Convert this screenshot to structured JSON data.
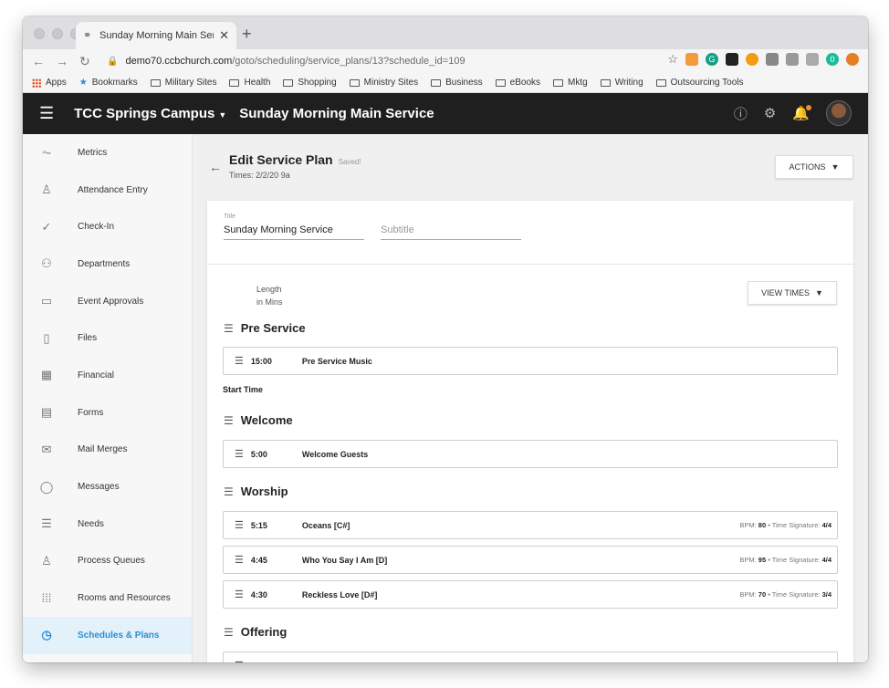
{
  "browser": {
    "tab_title": "Sunday Morning Main Service",
    "url_host": "demo70.ccbchurch.com",
    "url_path": "/goto/scheduling/service_plans/13?schedule_id=109",
    "bookmarks": [
      "Apps",
      "Bookmarks",
      "Military Sites",
      "Health",
      "Shopping",
      "Ministry Sites",
      "Business",
      "eBooks",
      "Mktg",
      "Writing",
      "Outsourcing Tools"
    ]
  },
  "header": {
    "campus": "TCC Springs Campus",
    "service": "Sunday Morning Main Service"
  },
  "sidebar": {
    "items": [
      {
        "label": "Metrics",
        "icon": "metrics-icon"
      },
      {
        "label": "Attendance Entry",
        "icon": "person-icon"
      },
      {
        "label": "Check-In",
        "icon": "check-circle-icon"
      },
      {
        "label": "Departments",
        "icon": "departments-icon"
      },
      {
        "label": "Event Approvals",
        "icon": "calendar-icon"
      },
      {
        "label": "Files",
        "icon": "file-icon"
      },
      {
        "label": "Financial",
        "icon": "calculator-icon"
      },
      {
        "label": "Forms",
        "icon": "clipboard-icon"
      },
      {
        "label": "Mail Merges",
        "icon": "mail-merge-icon"
      },
      {
        "label": "Messages",
        "icon": "chat-icon"
      },
      {
        "label": "Needs",
        "icon": "list-icon"
      },
      {
        "label": "Process Queues",
        "icon": "process-icon"
      },
      {
        "label": "Rooms and Resources",
        "icon": "grid-icon"
      },
      {
        "label": "Schedules & Plans",
        "icon": "clock-icon"
      }
    ]
  },
  "page": {
    "title": "Edit Service Plan",
    "saved": "Saved!",
    "times": "Times: 2/2/20 9a",
    "actions_label": "ACTIONS",
    "view_times_label": "VIEW TIMES",
    "title_label": "Title",
    "title_value": "Sunday Morning Service",
    "subtitle_placeholder": "Subtitle",
    "length_label_1": "Length",
    "length_label_2": "in Mins",
    "start_time_label": "Start Time"
  },
  "sections": {
    "pre_service": {
      "name": "Pre Service",
      "items": [
        {
          "length": "15:00",
          "name": "Pre Service Music"
        }
      ]
    },
    "welcome": {
      "name": "Welcome",
      "items": [
        {
          "length": "5:00",
          "name": "Welcome Guests"
        }
      ]
    },
    "worship": {
      "name": "Worship",
      "items": [
        {
          "length": "5:15",
          "name": "Oceans [C#]",
          "bpm": "80",
          "time_sig": "4/4"
        },
        {
          "length": "4:45",
          "name": "Who You Say I Am [D]",
          "bpm": "95",
          "time_sig": "4/4"
        },
        {
          "length": "4:30",
          "name": "Reckless Love [D#]",
          "bpm": "70",
          "time_sig": "3/4"
        }
      ]
    },
    "offering": {
      "name": "Offering"
    }
  },
  "labels": {
    "bpm": "BPM:",
    "time_sig": "Time Signature:"
  }
}
